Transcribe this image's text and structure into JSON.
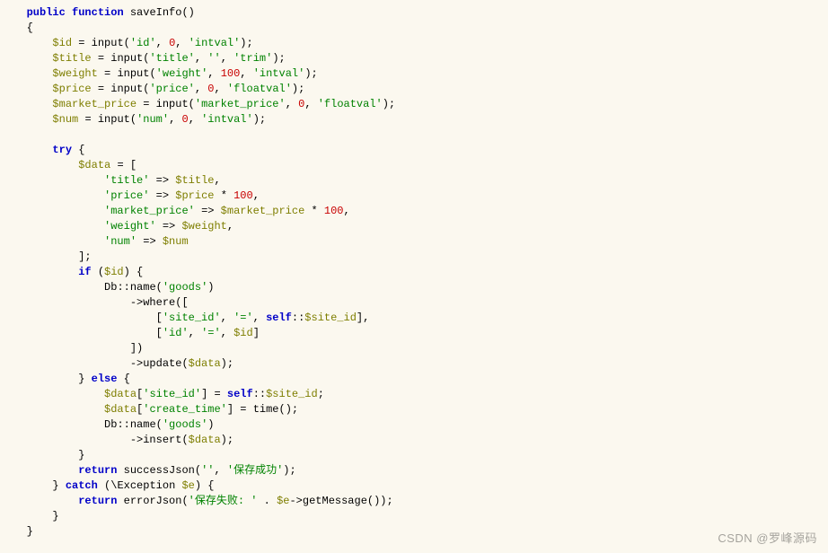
{
  "code": {
    "signature": {
      "visibility": "public",
      "keyword_function": "function",
      "name": "saveInfo"
    },
    "inputs": {
      "id": {
        "var": "$id",
        "param": "'id'",
        "default": "0",
        "cast": "'intval'"
      },
      "title": {
        "var": "$title",
        "param": "'title'",
        "default": "''",
        "cast": "'trim'"
      },
      "weight": {
        "var": "$weight",
        "param": "'weight'",
        "default": "100",
        "cast": "'intval'"
      },
      "price": {
        "var": "$price",
        "param": "'price'",
        "default": "0",
        "cast": "'floatval'"
      },
      "market_price": {
        "var": "$market_price",
        "param": "'market_price'",
        "default": "0",
        "cast": "'floatval'"
      },
      "num": {
        "var": "$num",
        "param": "'num'",
        "default": "0",
        "cast": "'intval'"
      }
    },
    "try_kw": "try",
    "data_var": "$data",
    "array": {
      "title": {
        "key": "'title'",
        "expr_var": "$title"
      },
      "price": {
        "key": "'price'",
        "expr_var": "$price",
        "times": "100"
      },
      "market_price": {
        "key": "'market_price'",
        "expr_var": "$market_price",
        "times": "100"
      },
      "weight": {
        "key": "'weight'",
        "expr_var": "$weight"
      },
      "num": {
        "key": "'num'",
        "expr_var": "$num"
      }
    },
    "if_kw": "if",
    "if_var": "$id",
    "db_class": "Db",
    "name_method": "name",
    "goods": "'goods'",
    "where_method": "where",
    "where_site_key": "'site_id'",
    "where_eq": "'='",
    "self_kw": "self",
    "site_id_prop": "$site_id",
    "where_id_key": "'id'",
    "where_id_var": "$id",
    "update_method": "update",
    "else_kw": "else",
    "assign_site_key": "'site_id'",
    "assign_ct_key": "'create_time'",
    "time_fn": "time",
    "insert_method": "insert",
    "return_kw": "return",
    "successJson": "successJson",
    "success_arg1": "''",
    "success_arg2": "'保存成功'",
    "catch_kw": "catch",
    "exception_cls": "Exception",
    "exc_var": "$e",
    "errorJson": "errorJson",
    "error_arg1": "'保存失败: '",
    "concat": ".",
    "getmsg": "getMessage"
  },
  "watermark": "CSDN @罗峰源码"
}
